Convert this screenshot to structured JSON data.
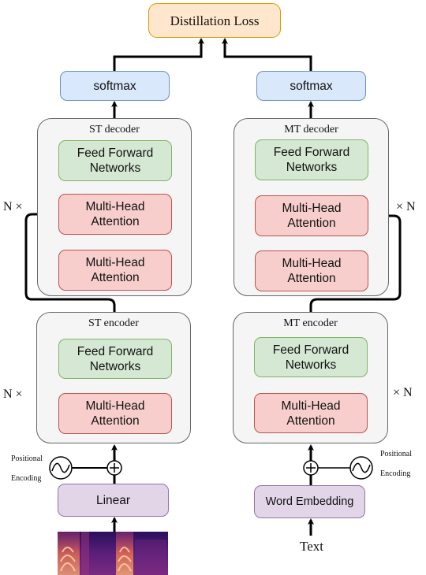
{
  "loss": {
    "label": "Distillation Loss"
  },
  "left": {
    "softmax": "softmax",
    "decoder": {
      "title": "ST decoder",
      "ffn": "Feed Forward Networks",
      "mha_cross": "Multi-Head Attention",
      "mha_self": "Multi-Head Attention",
      "repeat": "N ×"
    },
    "encoder": {
      "title": "ST encoder",
      "ffn": "Feed Forward Networks",
      "mha": "Multi-Head Attention",
      "repeat": "N ×"
    },
    "positional_encoding": [
      "Positional",
      "Encoding"
    ],
    "input_layer": "Linear",
    "input": "spectrogram"
  },
  "right": {
    "softmax": "softmax",
    "decoder": {
      "title": "MT decoder",
      "ffn": "Feed Forward Networks",
      "mha_cross": "Multi-Head Attention",
      "mha_self": "Multi-Head Attention",
      "repeat": "× N"
    },
    "encoder": {
      "title": "MT encoder",
      "ffn": "Feed Forward Networks",
      "mha": "Multi-Head Attention",
      "repeat": "× N"
    },
    "positional_encoding": [
      "Positional",
      "Encoding"
    ],
    "input_layer": "Word Embedding",
    "input": "Text"
  },
  "colors": {
    "loss_fill": "#ffe6cc",
    "loss_stroke": "#d79b00",
    "softmax_fill": "#dae8fc",
    "softmax_stroke": "#6c8ebf",
    "ffn_fill": "#d5e8d4",
    "ffn_stroke": "#82b366",
    "mha_fill": "#f8cecc",
    "mha_stroke": "#b85450",
    "embed_fill": "#e1d5e7",
    "embed_stroke": "#9673a6",
    "container_fill": "#f5f5f5",
    "container_stroke": "#666666"
  }
}
